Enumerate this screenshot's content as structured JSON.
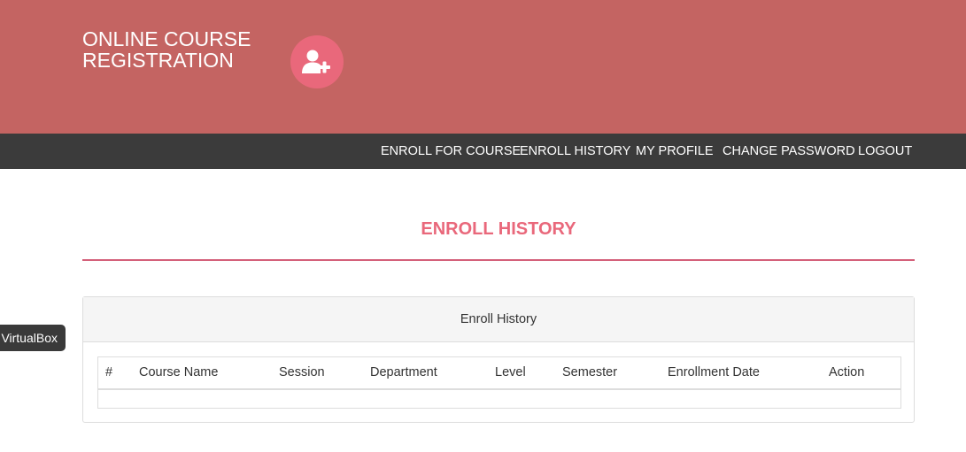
{
  "header": {
    "brand_line1": "ONLINE COURSE",
    "brand_line2": "REGISTRATION",
    "logo_icon": "user-plus-icon",
    "bg_color": "#c46462",
    "accent_color": "#e9687b"
  },
  "nav": {
    "items": [
      {
        "label": "ENROLL FOR COURSE"
      },
      {
        "label": "ENROLL HISTORY"
      },
      {
        "label": "MY PROFILE"
      },
      {
        "label": "CHANGE PASSWORD"
      },
      {
        "label": "LOGOUT"
      }
    ]
  },
  "page": {
    "title": "ENROLL HISTORY"
  },
  "tooltip": {
    "text": "VirtualBox"
  },
  "panel": {
    "heading": "Enroll History",
    "table": {
      "columns": [
        "#",
        "Course Name",
        "Session",
        "Department",
        "Level",
        "Semester",
        "Enrollment Date",
        "Action"
      ],
      "rows": []
    }
  }
}
